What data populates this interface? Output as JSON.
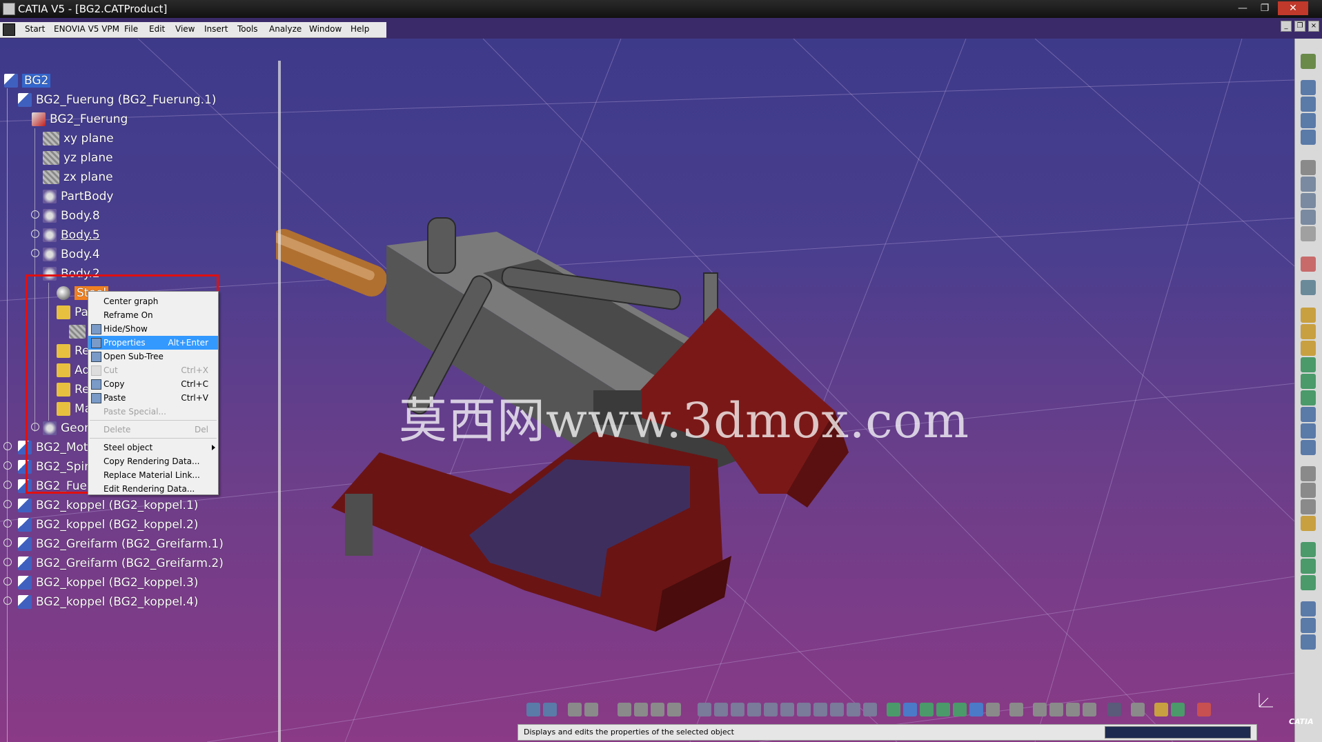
{
  "window": {
    "title": "CATIA V5 - [BG2.CATProduct]",
    "minimize": "—",
    "maximize": "❐",
    "close": "✕"
  },
  "menubar": {
    "items": [
      "Start",
      "ENOVIA V5 VPM",
      "File",
      "Edit",
      "View",
      "Insert",
      "Tools",
      "Analyze",
      "Window",
      "Help"
    ]
  },
  "tree": {
    "root": "BG2",
    "nodes": [
      {
        "label": "BG2_Fuerung (BG2_Fuerung.1)",
        "icon": "product-icon"
      },
      {
        "label": "BG2_Fuerung",
        "icon": "part-icon"
      },
      {
        "label": "xy plane",
        "icon": "plane-icon"
      },
      {
        "label": "yz plane",
        "icon": "plane-icon"
      },
      {
        "label": "zx plane",
        "icon": "plane-icon"
      },
      {
        "label": "PartBody",
        "icon": "body-icon"
      },
      {
        "label": "Body.8",
        "icon": "body-icon"
      },
      {
        "label": "Body.5",
        "icon": "body-icon"
      },
      {
        "label": "Body.4",
        "icon": "body-icon"
      },
      {
        "label": "Body.2",
        "icon": "body-icon"
      },
      {
        "label": "Steel",
        "icon": "steel-material-icon"
      },
      {
        "label": "Pad",
        "icon": "pad-icon"
      },
      {
        "label": "",
        "icon": "sketch-icon"
      },
      {
        "label": "Rem",
        "icon": "remove-icon"
      },
      {
        "label": "Add",
        "icon": "add-icon"
      },
      {
        "label": "Rem",
        "icon": "remove-icon"
      },
      {
        "label": "Ma",
        "icon": "material-icon"
      },
      {
        "label": "Geom",
        "icon": "geometrical-set-icon"
      },
      {
        "label": "BG2_Motor (",
        "icon": "product-icon"
      },
      {
        "label": "BG2_Spindel",
        "icon": "product-icon"
      },
      {
        "label": "BG2_Fuerung",
        "icon": "product-icon"
      },
      {
        "label": "BG2_koppel (BG2_koppel.1)",
        "icon": "product-icon"
      },
      {
        "label": "BG2_koppel (BG2_koppel.2)",
        "icon": "product-icon"
      },
      {
        "label": "BG2_Greifarm (BG2_Greifarm.1)",
        "icon": "product-icon"
      },
      {
        "label": "BG2_Greifarm (BG2_Greifarm.2)",
        "icon": "product-icon"
      },
      {
        "label": "BG2_koppel (BG2_koppel.3)",
        "icon": "product-icon"
      },
      {
        "label": "BG2_koppel (BG2_koppel.4)",
        "icon": "product-icon"
      }
    ]
  },
  "context_menu": {
    "items": [
      {
        "label": "Center graph",
        "shortcut": "",
        "state": "normal"
      },
      {
        "label": "Reframe On",
        "shortcut": "",
        "state": "normal"
      },
      {
        "label": "Hide/Show",
        "shortcut": "",
        "state": "normal"
      },
      {
        "label": "Properties",
        "shortcut": "Alt+Enter",
        "state": "highlighted"
      },
      {
        "label": "Open Sub-Tree",
        "shortcut": "",
        "state": "normal"
      },
      {
        "label": "Cut",
        "shortcut": "Ctrl+X",
        "state": "disabled"
      },
      {
        "label": "Copy",
        "shortcut": "Ctrl+C",
        "state": "normal"
      },
      {
        "label": "Paste",
        "shortcut": "Ctrl+V",
        "state": "normal"
      },
      {
        "label": "Paste Special...",
        "shortcut": "",
        "state": "disabled"
      },
      {
        "label": "Delete",
        "shortcut": "Del",
        "state": "disabled"
      },
      {
        "label": "Steel object",
        "shortcut": "",
        "state": "submenu"
      },
      {
        "label": "Copy Rendering Data...",
        "shortcut": "",
        "state": "normal"
      },
      {
        "label": "Replace Material Link...",
        "shortcut": "",
        "state": "normal"
      },
      {
        "label": "Edit Rendering Data...",
        "shortcut": "",
        "state": "normal"
      }
    ]
  },
  "watermark": "莫西网www.3dmox.com",
  "statusbar": {
    "message": "Displays and edits the properties of the selected object"
  },
  "logo": "CATIA",
  "colors": {
    "highlight": "#3399ff",
    "annotation_box": "#e01010",
    "tree_selection": "#3366cc",
    "material_selection": "#f08020",
    "model_frame": "#6a1414",
    "model_block": "#555555",
    "model_shaft": "#b07030"
  }
}
